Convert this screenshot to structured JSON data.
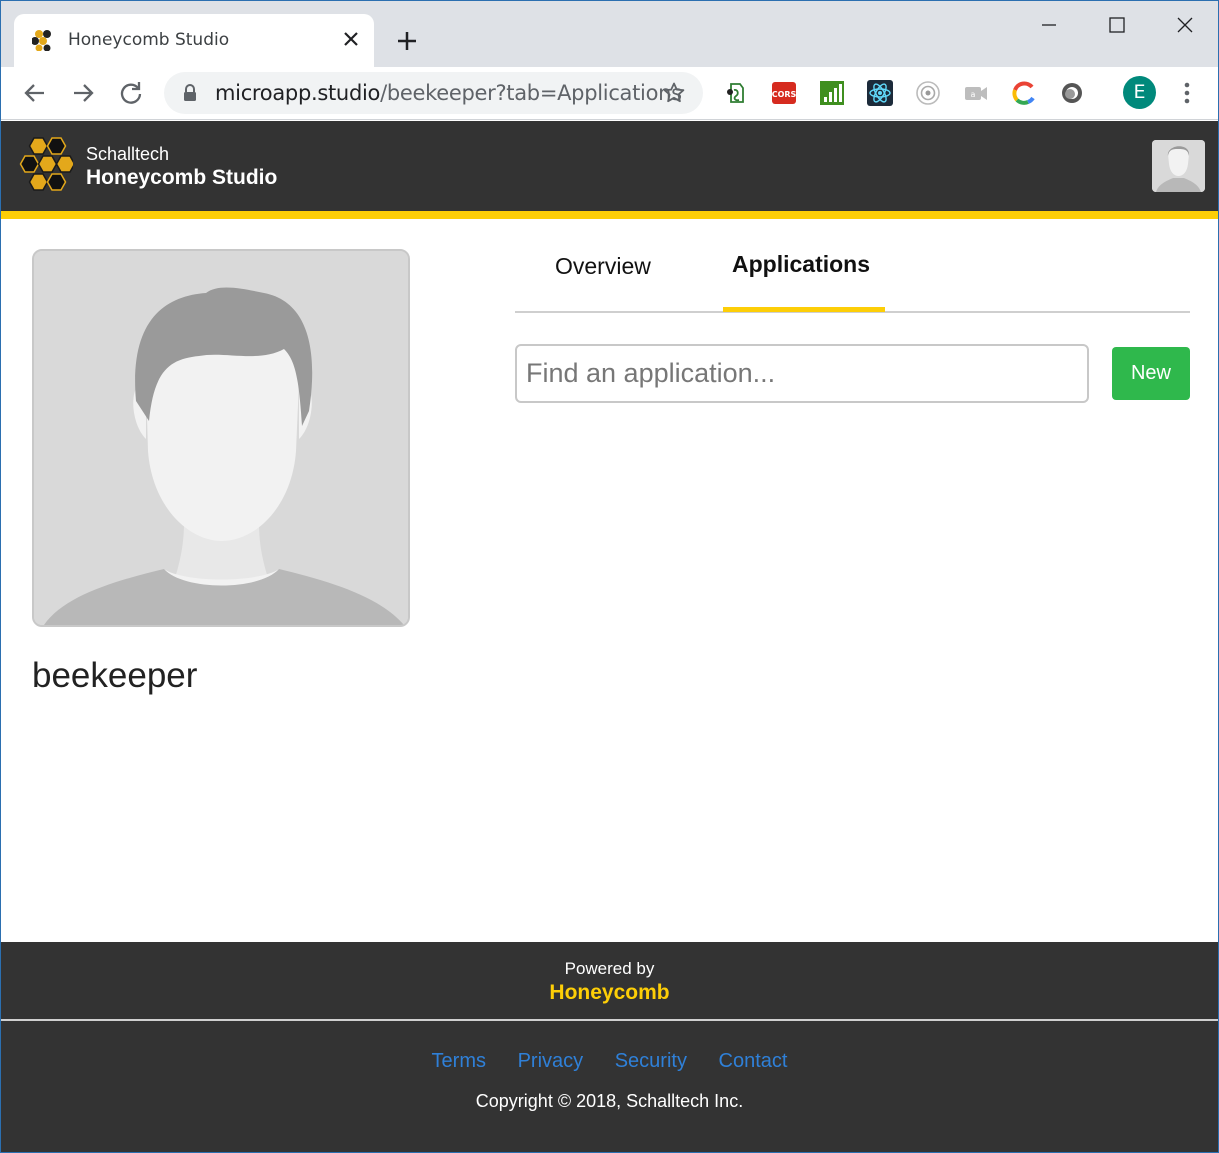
{
  "browser": {
    "tab_title": "Honeycomb Studio",
    "url_host": "microapp.studio",
    "url_path": "/beekeeper?tab=Applications",
    "profile_initial": "E",
    "icons": [
      "back-icon",
      "forward-icon",
      "reload-icon",
      "lock-icon",
      "star-icon",
      "menu-icon"
    ],
    "extensions": [
      "evernote-extension",
      "cors-extension",
      "analytics-extension",
      "react-devtools-extension",
      "target-extension",
      "camera-extension",
      "google-extension",
      "ring-extension"
    ]
  },
  "header": {
    "company": "Schalltech",
    "product": "Honeycomb Studio"
  },
  "colors": {
    "accent": "#fdce07",
    "dark": "#333333",
    "new_button": "#2fb84c",
    "link": "#2f80d8"
  },
  "profile": {
    "username": "beekeeper"
  },
  "tabs": [
    {
      "label": "Overview",
      "active": false
    },
    {
      "label": "Applications",
      "active": true
    }
  ],
  "search": {
    "placeholder": "Find an application...",
    "value": ""
  },
  "new_button": "New",
  "footer": {
    "powered_by": "Powered by",
    "brand": "Honeycomb",
    "links": [
      "Terms",
      "Privacy",
      "Security",
      "Contact"
    ],
    "copyright": "Copyright © 2018, Schalltech Inc."
  }
}
